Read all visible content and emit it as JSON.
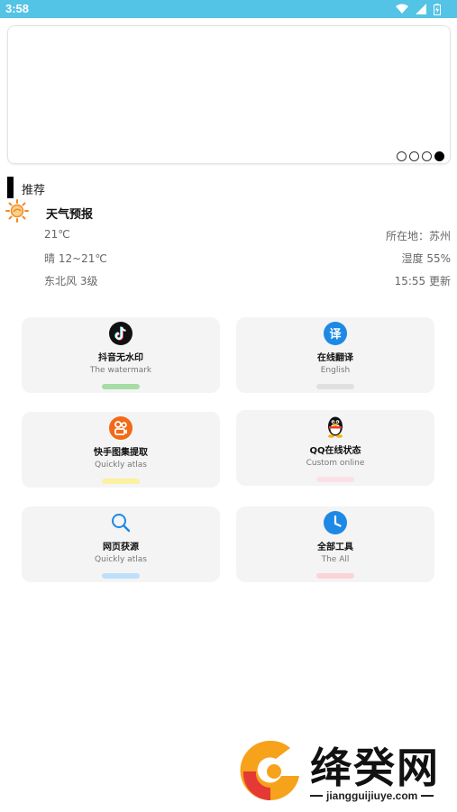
{
  "statusbar": {
    "time": "3:58"
  },
  "banner": {
    "dot_count": 4,
    "active_index": 3
  },
  "section": {
    "title": "推荐"
  },
  "weather": {
    "title": "天气预报",
    "temperature": "21℃",
    "range": "晴 12~21℃",
    "wind": "东北风 3级",
    "location": "所在地：苏州",
    "humidity": "湿度 55%",
    "updated": "15:55 更新"
  },
  "tools": [
    {
      "title": "抖音无水印",
      "subtitle": "The watermark",
      "icon": "tiktok-icon",
      "bar_color": "#a6dca6"
    },
    {
      "title": "在线翻译",
      "subtitle": "English",
      "icon": "translate-icon",
      "bar_color": "#e0e0e0"
    },
    {
      "title": "快手图集提取",
      "subtitle": "Quickly atlas",
      "icon": "kuaishou-icon",
      "bar_color": "#fbf1a0"
    },
    {
      "title": "QQ在线状态",
      "subtitle": "Custom online",
      "icon": "qq-penguin-icon",
      "bar_color": "#fbe0e5"
    },
    {
      "title": "网页获源",
      "subtitle": "Quickly atlas",
      "icon": "search-icon",
      "bar_color": "#bfe0fb"
    },
    {
      "title": "全部工具",
      "subtitle": "The All",
      "icon": "clock-icon",
      "bar_color": "#fbd3d8"
    }
  ],
  "watermark": {
    "name": "绛癸网",
    "url": "jiangguijiuye.com"
  },
  "colors": {
    "statusbar": "#53c3e6",
    "accent_blue": "#1e88e5",
    "kuaishou_orange": "#f26a17"
  }
}
